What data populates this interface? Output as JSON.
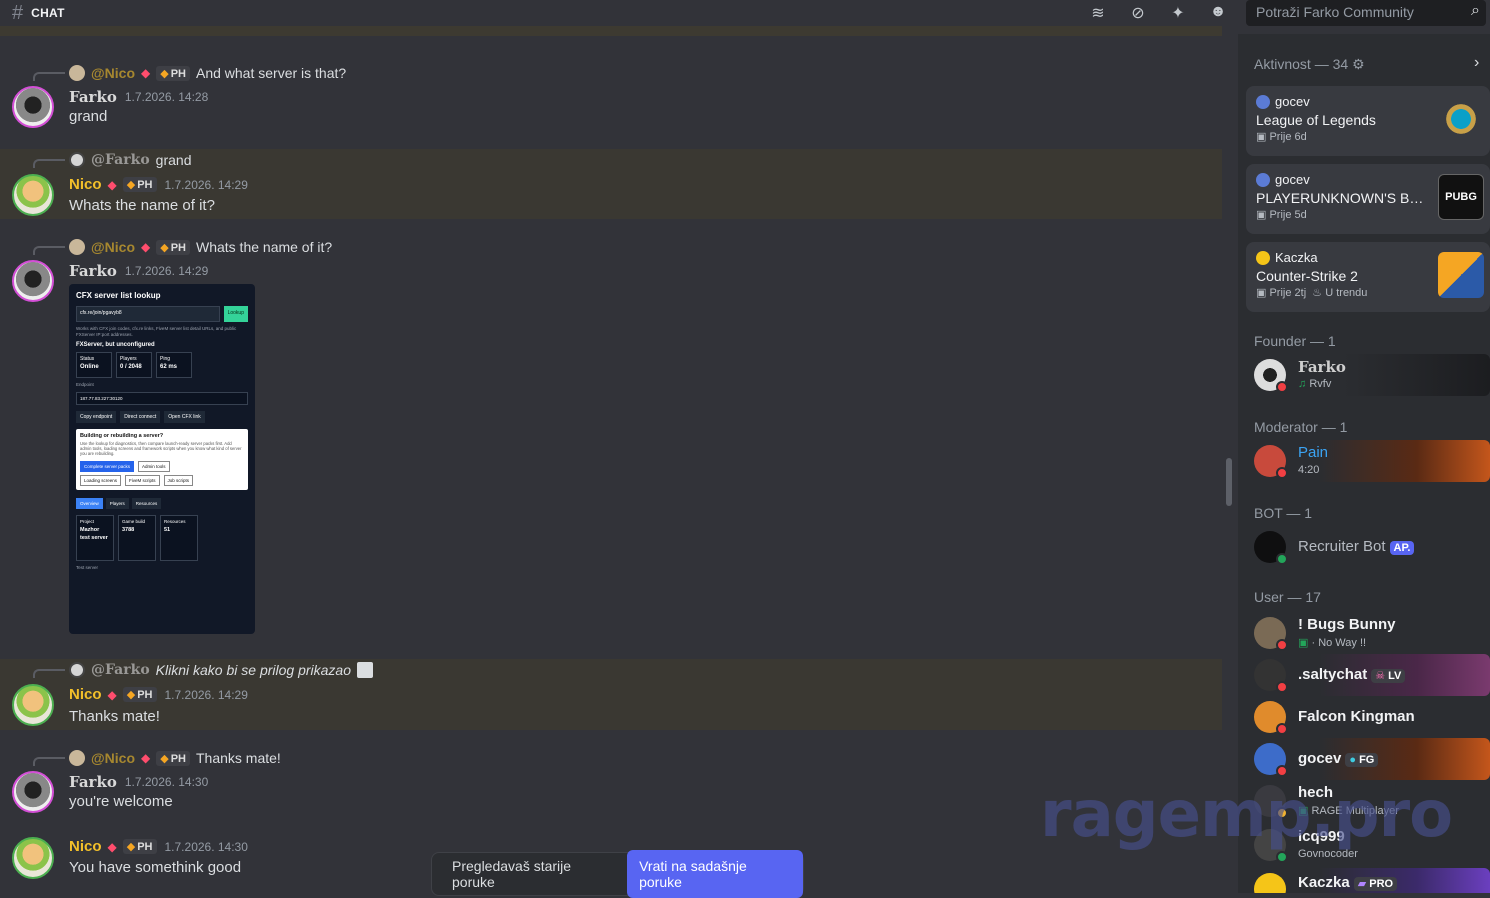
{
  "channel": {
    "name": "CHAT"
  },
  "toolbar": {
    "icons": [
      "threads-icon",
      "mute-icon",
      "pin-icon",
      "members-icon"
    ]
  },
  "search": {
    "placeholder": "Potraži Farko Community"
  },
  "messages": [
    {
      "reply_name": "@Nico",
      "reply_tag": "PH",
      "reply_text": "And what server is that?",
      "author": "Farko",
      "time": "1.7.2026. 14:28",
      "text": "grand"
    },
    {
      "reply_name": "@Farko",
      "reply_text": "grand",
      "author": "Nico",
      "tag": "PH",
      "time": "1.7.2026. 14:29",
      "text": "Whats the name of it?"
    },
    {
      "reply_name": "@Nico",
      "reply_tag": "PH",
      "reply_text": "Whats the name of it?",
      "author": "Farko",
      "time": "1.7.2026. 14:29"
    },
    {
      "reply_name": "@Farko",
      "reply_text": "Klikni kako bi se prilog prikazao",
      "author": "Nico",
      "tag": "PH",
      "time": "1.7.2026. 14:29",
      "text": "Thanks mate!"
    },
    {
      "reply_name": "@Nico",
      "reply_tag": "PH",
      "reply_text": "Thanks mate!",
      "author": "Farko",
      "time": "1.7.2026. 14:30",
      "text": "you're welcome"
    },
    {
      "author": "Nico",
      "tag": "PH",
      "time": "1.7.2026. 14:30",
      "text": "You have somethink good"
    }
  ],
  "attachment": {
    "title": "CFX server list lookup",
    "input": "cfx.re/join/pgavyb8",
    "lookup": "Lookup",
    "desc": "Works with CFX join codes, cfx.re links, FiveM server list detail URLs, and public FXServer IP:port addresses.",
    "subtitle": "FXServer, but unconfigured",
    "stats": [
      {
        "label": "Status",
        "value": "Online"
      },
      {
        "label": "Players",
        "value": "0 / 2048"
      },
      {
        "label": "Ping",
        "value": "62 ms"
      }
    ],
    "endpoint_label": "Endpoint",
    "endpoint": "187.77.83.227:30120",
    "buttons": [
      "Copy endpoint",
      "Direct connect",
      "Open CFX link"
    ],
    "card_title": "Building or rebuilding a server?",
    "card_text": "Use the lookup for diagnostics, then compare launch-ready server packs first. Add admin tools, loading screens and framework scripts when you know what kind of server you are rebuilding.",
    "card_buttons": [
      "Complete server packs",
      "Admin tools",
      "Loading screens",
      "FiveM scripts",
      "Job scripts"
    ],
    "tabs": [
      "Overview",
      "Players",
      "Resources"
    ],
    "info": [
      {
        "label": "Project",
        "value": "Mazhor test server"
      },
      {
        "label": "Game build",
        "value": "3788"
      },
      {
        "label": "Resources",
        "value": "51"
      }
    ],
    "footer": "Test server"
  },
  "jump": {
    "text": "Pregledavaš starije poruke",
    "button": "Vrati na sadašnje poruke"
  },
  "sidebar": {
    "activity_header": "Aktivnost — 34",
    "activities": [
      {
        "user": "gocev",
        "game": "League of Legends",
        "since": "Prije 6d"
      },
      {
        "user": "gocev",
        "game": "PLAYERUNKNOWN'S BAT...",
        "since": "Prije 5d",
        "logo": "PUBG"
      },
      {
        "user": "Kaczka",
        "game": "Counter-Strike 2",
        "since": "Prije 2tj",
        "extra": "U trendu"
      }
    ],
    "founder_header": "Founder — 1",
    "moderator_header": "Moderator — 1",
    "bot_header": "BOT — 1",
    "user_header": "User — 17",
    "members": [
      {
        "name": "Farko",
        "status": "Rvfv"
      },
      {
        "name": "Pain",
        "status": "4:20"
      },
      {
        "name": "Recruiter Bot",
        "badge": "AP."
      },
      {
        "name": "! Bugs Bunny",
        "status": "No Way !!"
      },
      {
        "name": ".saltychat",
        "badge": "LV"
      },
      {
        "name": "Falcon Kingman"
      },
      {
        "name": "gocev",
        "badge": "FG"
      },
      {
        "name": "hech",
        "status": "RAGE Multiplayer"
      },
      {
        "name": "icq999",
        "status": "Govnocoder"
      },
      {
        "name": "Kaczka",
        "badge": "PRO"
      }
    ]
  },
  "watermark": "ragemp.pro",
  "colors": {
    "accent": "#5865f2",
    "nico": "#f3c02a",
    "highlight": "#3a3832",
    "online": "#23a55a",
    "dnd": "#f23f43"
  }
}
